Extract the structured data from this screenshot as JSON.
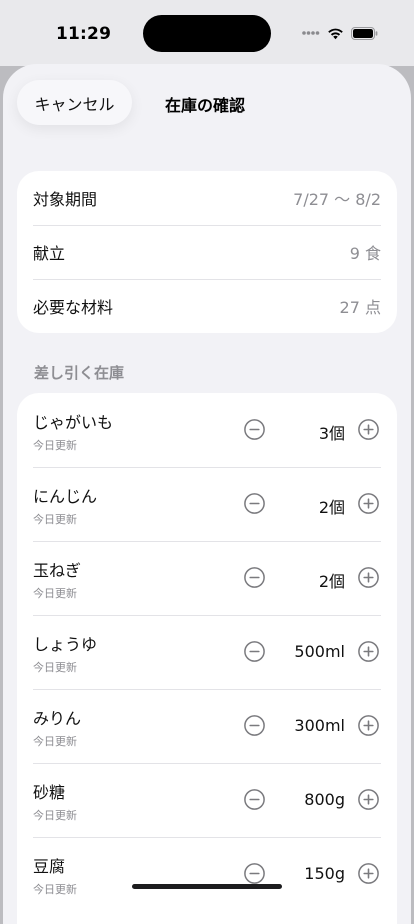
{
  "status_bar": {
    "time": "11:29"
  },
  "sheet": {
    "cancel_label": "キャンセル",
    "title": "在庫の確認"
  },
  "summary": [
    {
      "label": "対象期間",
      "value": "7/27 〜 8/2"
    },
    {
      "label": "献立",
      "value": "9 食"
    },
    {
      "label": "必要な材料",
      "value": "27 点"
    }
  ],
  "inventory": {
    "section_title": "差し引く在庫",
    "items": [
      {
        "name": "じゃがいも",
        "updated": "今日更新",
        "quantity": "3個"
      },
      {
        "name": "にんじん",
        "updated": "今日更新",
        "quantity": "2個"
      },
      {
        "name": "玉ねぎ",
        "updated": "今日更新",
        "quantity": "2個"
      },
      {
        "name": "しょうゆ",
        "updated": "今日更新",
        "quantity": "500ml"
      },
      {
        "name": "みりん",
        "updated": "今日更新",
        "quantity": "300ml"
      },
      {
        "name": "砂糖",
        "updated": "今日更新",
        "quantity": "800g"
      },
      {
        "name": "豆腐",
        "updated": "今日更新",
        "quantity": "150g"
      }
    ]
  },
  "icons": {
    "minus": "minus-circle-icon",
    "plus": "plus-circle-icon"
  },
  "colors": {
    "background": "#f2f2f6",
    "secondary_text": "#8e8e93",
    "stepper_icon": "#7a7a7e"
  }
}
